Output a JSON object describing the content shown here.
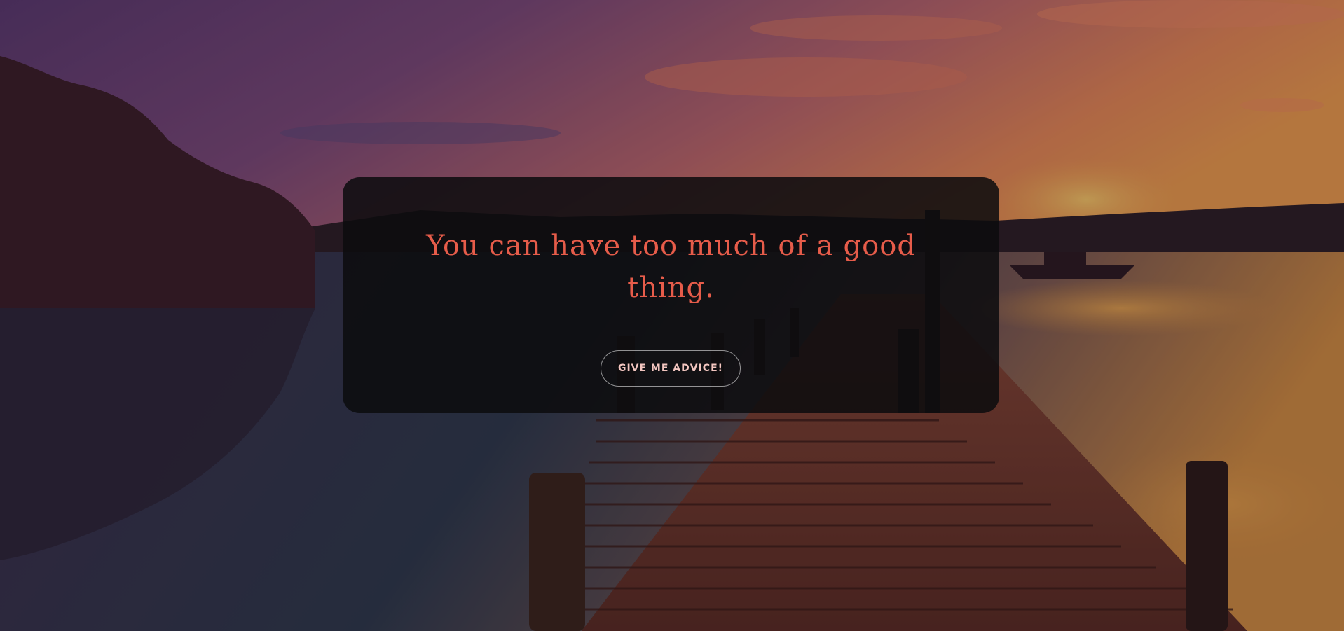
{
  "quote": {
    "text": "You can have too much of a good thing."
  },
  "button": {
    "label": "GIVE ME ADVICE!"
  },
  "colors": {
    "quote_text": "#e65c4a",
    "card_background": "#0c0c0e",
    "button_border": "#ffffff",
    "button_text": "#f3c6c0"
  },
  "background": {
    "description_icon": "sunset-pier-photo"
  }
}
